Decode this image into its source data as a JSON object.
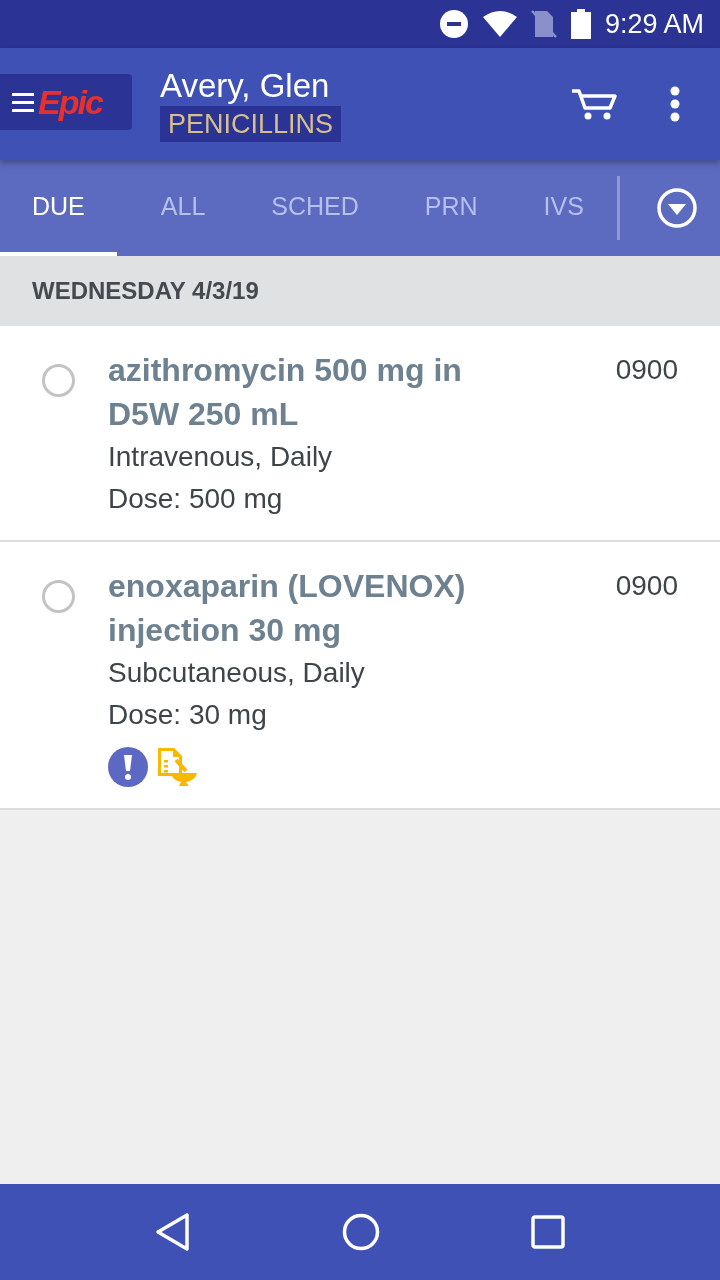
{
  "status_bar": {
    "time": "9:29 AM"
  },
  "app_bar": {
    "logo": "Epic",
    "patient_name": "Avery, Glen",
    "allergy": "PENICILLINS"
  },
  "tabs": [
    {
      "label": "DUE",
      "selected": true
    },
    {
      "label": "ALL",
      "selected": false
    },
    {
      "label": "SCHED",
      "selected": false
    },
    {
      "label": "PRN",
      "selected": false
    },
    {
      "label": "IVS",
      "selected": false
    }
  ],
  "date_header": "WEDNESDAY 4/3/19",
  "medications": [
    {
      "name": "azithromycin 500 mg in D5W 250 mL",
      "route": "Intravenous, Daily",
      "dose": "Dose: 500 mg",
      "time": "0900",
      "checked": false
    },
    {
      "name": "enoxaparin (LOVENOX) injection 30 mg",
      "route": "Subcutaneous, Daily",
      "dose": "Dose: 30 mg",
      "time": "0900",
      "checked": false,
      "indicators": [
        {
          "kind": "alert"
        },
        {
          "kind": "pharmacy-note"
        }
      ]
    }
  ]
}
